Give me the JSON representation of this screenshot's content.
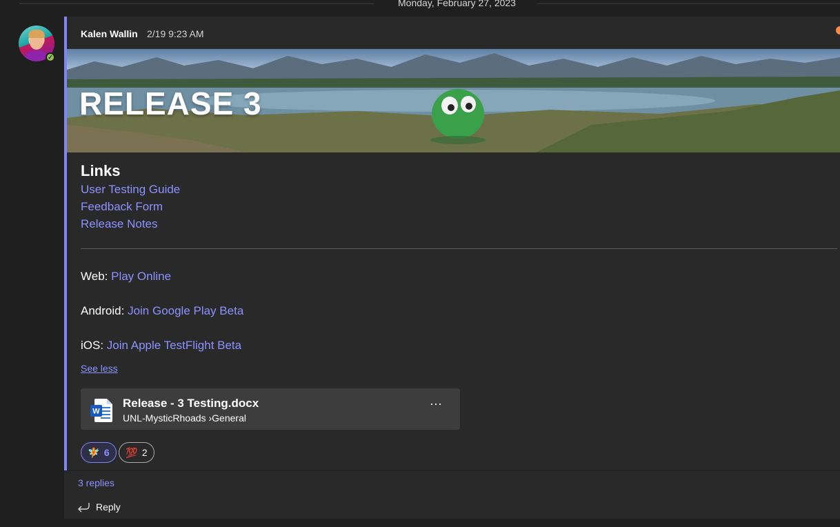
{
  "date_divider": "Monday, February 27, 2023",
  "message": {
    "author": "Kalen Wallin",
    "timestamp": "2/19 9:23 AM",
    "banner_title": "RELEASE 3",
    "links_heading": "Links",
    "links": [
      "User Testing Guide",
      "Feedback Form",
      "Release Notes"
    ],
    "web": {
      "label": "Web:",
      "link": "Play Online"
    },
    "android": {
      "label": "Android:",
      "link": "Join Google Play Beta"
    },
    "ios": {
      "label": "iOS:",
      "link": "Join Apple TestFlight Beta"
    },
    "see_less": "See less"
  },
  "attachment": {
    "file_name": "Release - 3 Testing.docx",
    "team": "UNL-MysticRhoads",
    "channel": "General",
    "more": "···",
    "icon": "word-icon"
  },
  "reactions": [
    {
      "emoji": "🧚",
      "count": "6"
    },
    {
      "emoji": "💯",
      "count": "2"
    }
  ],
  "replies": {
    "count_label": "3 replies",
    "reply_label": "Reply"
  },
  "colors": {
    "accent": "#7f85f5",
    "link": "#8d92ff",
    "background": "#1f1f1f",
    "card": "#292929",
    "presence": "#92c353"
  }
}
